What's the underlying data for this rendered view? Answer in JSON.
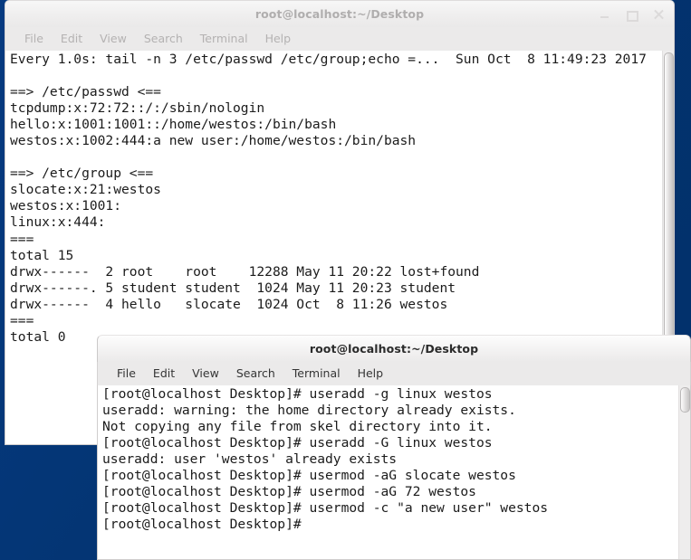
{
  "desktop": {
    "background_color": "#04377c"
  },
  "windows": {
    "back": {
      "title": "root@localhost:~/Desktop",
      "state": "inactive",
      "menu": [
        "File",
        "Edit",
        "View",
        "Search",
        "Terminal",
        "Help"
      ],
      "buttons": {
        "minimize": "minimize-icon",
        "maximize": "maximize-icon",
        "close": "close-icon"
      },
      "terminal_text": "Every 1.0s: tail -n 3 /etc/passwd /etc/group;echo =...  Sun Oct  8 11:49:23 2017\n\n==> /etc/passwd <==\ntcpdump:x:72:72::/:/sbin/nologin\nhello:x:1001:1001::/home/westos:/bin/bash\nwestos:x:1002:444:a new user:/home/westos:/bin/bash\n\n==> /etc/group <==\nslocate:x:21:westos\nwestos:x:1001:\nlinux:x:444:\n===\ntotal 15\ndrwx------  2 root    root    12288 May 11 20:22 lost+found\ndrwx------. 5 student student  1024 May 11 20:23 student\ndrwx------  4 hello   slocate  1024 Oct  8 11:26 westos\n===\ntotal 0"
    },
    "front": {
      "title": "root@localhost:~/Desktop",
      "state": "active",
      "menu": [
        "File",
        "Edit",
        "View",
        "Search",
        "Terminal",
        "Help"
      ],
      "terminal_text": "[root@localhost Desktop]# useradd -g linux westos\nuseradd: warning: the home directory already exists.\nNot copying any file from skel directory into it.\n[root@localhost Desktop]# useradd -G linux westos\nuseradd: user 'westos' already exists\n[root@localhost Desktop]# usermod -aG slocate westos\n[root@localhost Desktop]# usermod -aG 72 westos\n[root@localhost Desktop]# usermod -c \"a new user\" westos\n[root@localhost Desktop]# "
    }
  }
}
